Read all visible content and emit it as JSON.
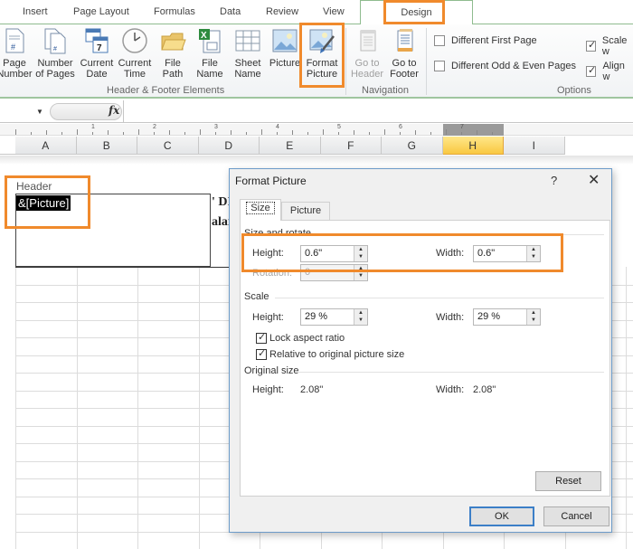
{
  "ribbon": {
    "tabs": [
      "Insert",
      "Page Layout",
      "Formulas",
      "Data",
      "Review",
      "View",
      "Design"
    ],
    "active_tab": "Design",
    "groups": {
      "header_footer_elements": {
        "label": "Header & Footer Elements",
        "buttons": [
          {
            "line1": "Page",
            "line2": "Number",
            "icon": "page-number-icon"
          },
          {
            "line1": "Number",
            "line2": "of Pages",
            "icon": "number-of-pages-icon"
          },
          {
            "line1": "Current",
            "line2": "Date",
            "icon": "calendar-icon"
          },
          {
            "line1": "Current",
            "line2": "Time",
            "icon": "clock-icon"
          },
          {
            "line1": "File",
            "line2": "Path",
            "icon": "folder-icon"
          },
          {
            "line1": "File",
            "line2": "Name",
            "icon": "excel-file-icon"
          },
          {
            "line1": "Sheet",
            "line2": "Name",
            "icon": "sheet-icon"
          },
          {
            "line1": "Picture",
            "line2": "",
            "icon": "picture-icon"
          },
          {
            "line1": "Format",
            "line2": "Picture",
            "icon": "format-picture-icon"
          }
        ]
      },
      "navigation": {
        "label": "Navigation",
        "buttons": [
          {
            "line1": "Go to",
            "line2": "Header",
            "icon": "go-to-header-icon",
            "disabled": true
          },
          {
            "line1": "Go to",
            "line2": "Footer",
            "icon": "go-to-footer-icon",
            "disabled": false
          }
        ]
      },
      "options": {
        "label": "Options",
        "checkboxes": [
          {
            "label": "Different First Page",
            "checked": false
          },
          {
            "label": "Different Odd & Even Pages",
            "checked": false
          },
          {
            "label": "Scale w",
            "checked": true
          },
          {
            "label": "Align w",
            "checked": true
          }
        ]
      }
    }
  },
  "formula_bar": {
    "fx_label": "fx",
    "value": ""
  },
  "sheet": {
    "ruler_numbers": [
      "1",
      "2",
      "3",
      "4",
      "5",
      "6",
      "7"
    ],
    "columns": [
      "A",
      "B",
      "C",
      "D",
      "E",
      "F",
      "G",
      "H",
      "I"
    ],
    "selected_column": "H",
    "header_label": "Header",
    "header_code": "&[Picture]",
    "bg_text_line1": "' DI",
    "bg_text_line2": "alar"
  },
  "dialog": {
    "title": "Format Picture",
    "help": "?",
    "close": "✕",
    "tabs": [
      "Size",
      "Picture"
    ],
    "active_tab": "Size",
    "size_and_rotate": {
      "section": "Size and rotate",
      "height_label": "Height:",
      "height_value": "0.6\"",
      "width_label": "Width:",
      "width_value": "0.6\"",
      "rotation_label": "Rotation:",
      "rotation_value": "0"
    },
    "scale": {
      "section": "Scale",
      "height_label": "Height:",
      "height_value": "29 %",
      "width_label": "Width:",
      "width_value": "29 %",
      "lock_aspect_label": "Lock aspect ratio",
      "lock_aspect_checked": true,
      "relative_label": "Relative to original picture size",
      "relative_checked": true
    },
    "original_size": {
      "section": "Original size",
      "height_label": "Height:",
      "height_value": "2.08\"",
      "width_label": "Width:",
      "width_value": "2.08\""
    },
    "reset_label": "Reset",
    "ok_label": "OK",
    "cancel_label": "Cancel"
  },
  "colors": {
    "highlight_orange": "#f08a2c",
    "selected_column": "#f9c841",
    "dialog_border": "#6c9bc9"
  }
}
